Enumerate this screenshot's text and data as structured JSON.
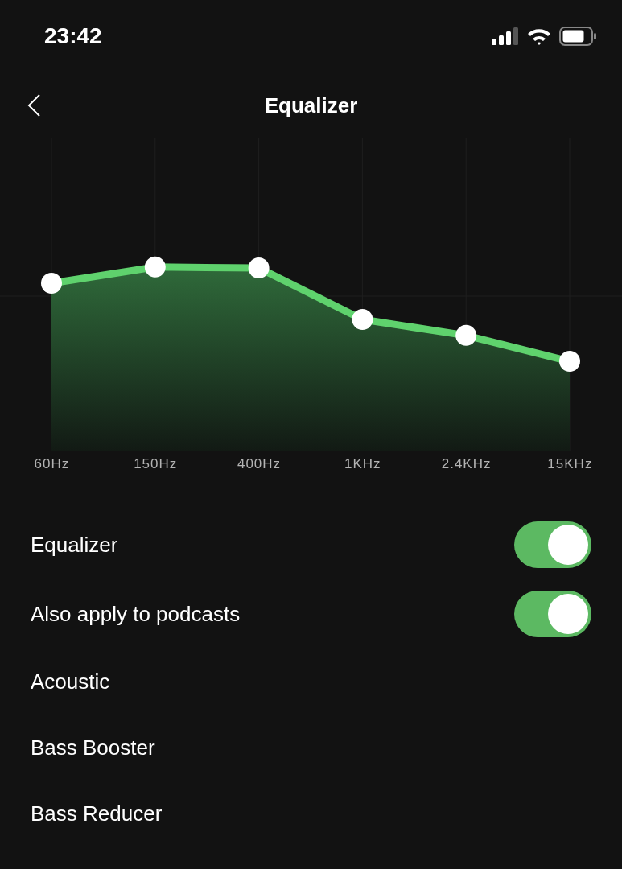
{
  "status_bar": {
    "time": "23:42"
  },
  "header": {
    "title": "Equalizer"
  },
  "bands": [
    {
      "label": "60Hz"
    },
    {
      "label": "150Hz"
    },
    {
      "label": "400Hz"
    },
    {
      "label": "1KHz"
    },
    {
      "label": "2.4KHz"
    },
    {
      "label": "15KHz"
    }
  ],
  "settings": [
    {
      "kind": "toggle",
      "label": "Equalizer",
      "on": true
    },
    {
      "kind": "toggle",
      "label": "Also apply to podcasts",
      "on": true
    },
    {
      "kind": "preset",
      "label": "Acoustic"
    },
    {
      "kind": "preset",
      "label": "Bass Booster"
    },
    {
      "kind": "preset",
      "label": "Bass Reducer"
    }
  ]
}
